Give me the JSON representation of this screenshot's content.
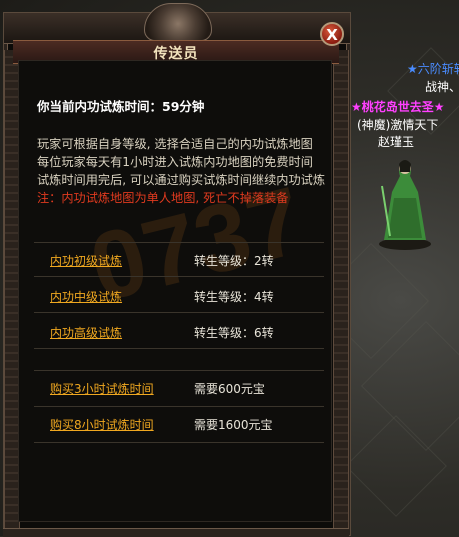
{
  "dialog": {
    "title": "传送员",
    "close_label": "X",
    "heading": "你当前内功试炼时间：59分钟",
    "description": [
      "玩家可根据自身等级, 选择合适自己的内功试炼地图",
      "每位玩家每天有1小时进入试炼内功地图的免费时间",
      "试炼时间用完后, 可以通过购买试炼时间继续内功试炼"
    ],
    "warning": "注：内功试炼地图为单人地图, 死亡不掉落装备",
    "trials": [
      {
        "label": "内功初级试炼",
        "requirement": "转生等级：2转"
      },
      {
        "label": "内功中级试炼",
        "requirement": "转生等级：4转"
      },
      {
        "label": "内功高级试炼",
        "requirement": "转生等级：6转"
      }
    ],
    "purchases": [
      {
        "label": "购买3小时试炼时间",
        "cost": "需要600元宝"
      },
      {
        "label": "购买8小时试炼时间",
        "cost": "需要1600元宝"
      }
    ]
  },
  "world": {
    "labels": {
      "guild_tag": "★六阶斩轩",
      "battle_god": "战神、",
      "title_star": "★桃花岛世去圣★",
      "faction": "(神魔)激情天下",
      "player_name": "赵瑾玉"
    }
  },
  "colors": {
    "link": "#f0a820",
    "warning": "#e03a1f",
    "title_text": "#f2e3bd"
  }
}
